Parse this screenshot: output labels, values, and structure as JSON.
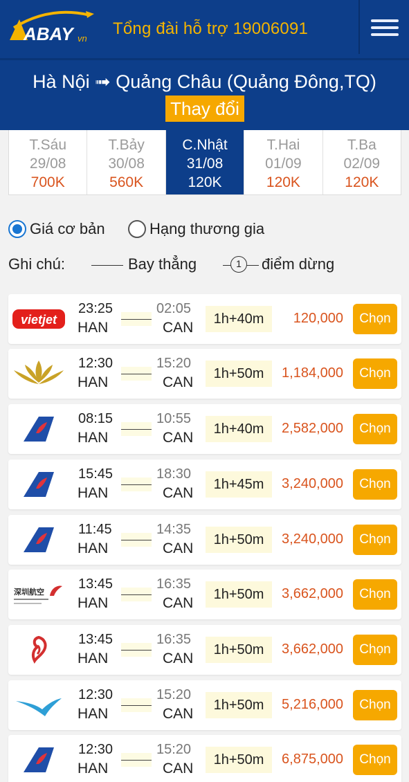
{
  "header": {
    "logo_text": "ABAY",
    "logo_suffix": "vn",
    "hotline": "Tổng đài hỗ trợ 19006091",
    "menu_icon": "hamburger-icon"
  },
  "route": {
    "text": "Hà Nội ➟ Quảng Châu (Quảng Đông,TQ)",
    "change_label": "Thay đổi"
  },
  "dates": [
    {
      "day": "T.Sáu",
      "date": "29/08",
      "price": "700K"
    },
    {
      "day": "T.Bảy",
      "date": "30/08",
      "price": "560K"
    },
    {
      "day": "C.Nhật",
      "date": "31/08",
      "price": "120K",
      "active": true
    },
    {
      "day": "T.Hai",
      "date": "01/09",
      "price": "120K"
    },
    {
      "day": "T.Ba",
      "date": "02/09",
      "price": "120K"
    }
  ],
  "options": {
    "basic": "Giá cơ bản",
    "business": "Hạng thương gia",
    "selected": "basic"
  },
  "legend": {
    "title": "Ghi chú:",
    "direct": "Bay thẳng",
    "stop_number": "1",
    "stop": "điểm dừng"
  },
  "flights": [
    {
      "airline_icon": "vietjet-logo",
      "dep_time": "23:25",
      "dep_code": "HAN",
      "arr_time": "02:05",
      "arr_code": "CAN",
      "duration": "1h+40m",
      "price": "120,000",
      "button": "Chọn"
    },
    {
      "airline_icon": "vietnam-airlines-lotus-logo",
      "dep_time": "12:30",
      "dep_code": "HAN",
      "arr_time": "15:20",
      "arr_code": "CAN",
      "duration": "1h+50m",
      "price": "1,184,000",
      "button": "Chọn"
    },
    {
      "airline_icon": "china-southern-logo",
      "dep_time": "08:15",
      "dep_code": "HAN",
      "arr_time": "10:55",
      "arr_code": "CAN",
      "duration": "1h+40m",
      "price": "2,582,000",
      "button": "Chọn"
    },
    {
      "airline_icon": "china-southern-logo",
      "dep_time": "15:45",
      "dep_code": "HAN",
      "arr_time": "18:30",
      "arr_code": "CAN",
      "duration": "1h+45m",
      "price": "3,240,000",
      "button": "Chọn"
    },
    {
      "airline_icon": "china-southern-logo",
      "dep_time": "11:45",
      "dep_code": "HAN",
      "arr_time": "14:35",
      "arr_code": "CAN",
      "duration": "1h+50m",
      "price": "3,240,000",
      "button": "Chọn"
    },
    {
      "airline_icon": "shenzhen-airlines-logo",
      "dep_time": "13:45",
      "dep_code": "HAN",
      "arr_time": "16:35",
      "arr_code": "CAN",
      "duration": "1h+50m",
      "price": "3,662,000",
      "button": "Chọn"
    },
    {
      "airline_icon": "air-china-logo",
      "dep_time": "13:45",
      "dep_code": "HAN",
      "arr_time": "16:35",
      "arr_code": "CAN",
      "duration": "1h+50m",
      "price": "3,662,000",
      "button": "Chọn"
    },
    {
      "airline_icon": "xiamen-airlines-logo",
      "dep_time": "12:30",
      "dep_code": "HAN",
      "arr_time": "15:20",
      "arr_code": "CAN",
      "duration": "1h+50m",
      "price": "5,216,000",
      "button": "Chọn"
    },
    {
      "airline_icon": "china-southern-logo",
      "dep_time": "12:30",
      "dep_code": "HAN",
      "arr_time": "15:20",
      "arr_code": "CAN",
      "duration": "1h+50m",
      "price": "6,875,000",
      "button": "Chọn"
    }
  ],
  "colors": {
    "brand_blue": "#0d3e8a",
    "accent_orange": "#f6a800",
    "price_red": "#d9541e"
  }
}
